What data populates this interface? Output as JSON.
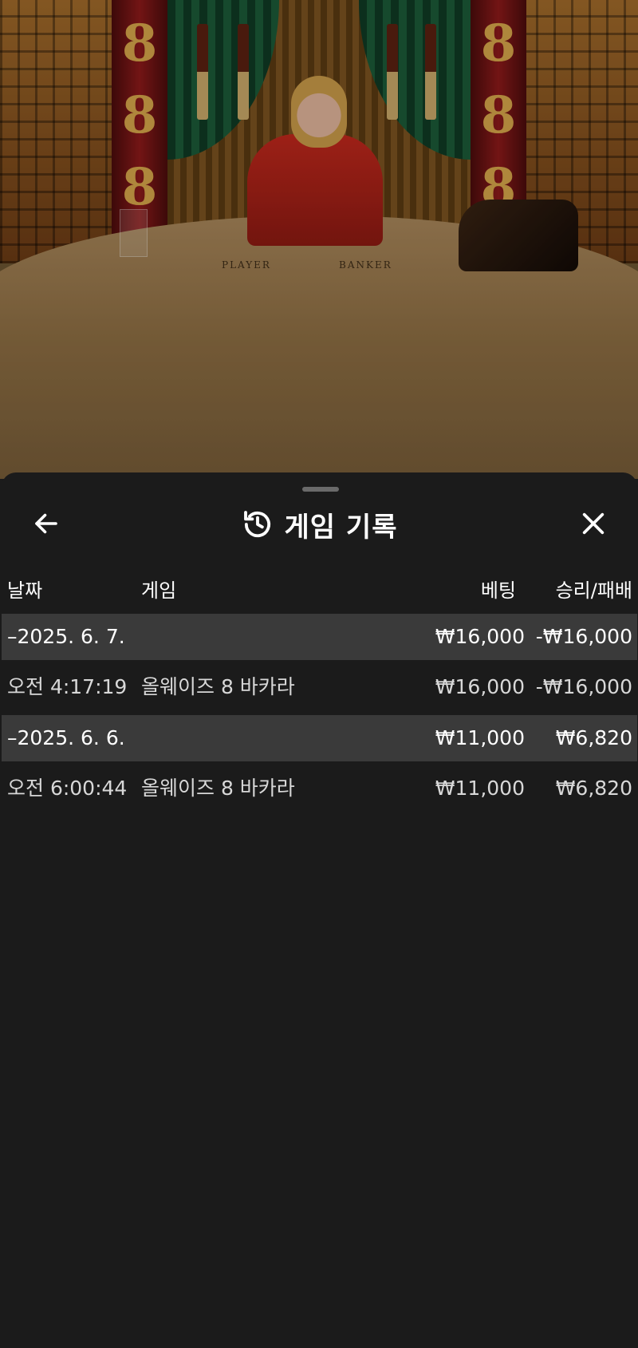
{
  "video": {
    "table_labels": {
      "player": "PLAYER",
      "banker": "BANKER"
    },
    "pillar_glyph": "8"
  },
  "sheet": {
    "title": "게임 기록",
    "icons": {
      "back": "arrow-left-icon",
      "history": "history-icon",
      "close": "close-icon"
    }
  },
  "columns": {
    "date": "날짜",
    "game": "게임",
    "bet": "베팅",
    "winloss": "승리/패배"
  },
  "rows": [
    {
      "type": "date",
      "date": "–2025. 6. 7.",
      "bet": "₩16,000",
      "winloss": "-₩16,000"
    },
    {
      "type": "item",
      "time": "오전 4:17:19",
      "game": "올웨이즈 8 바카라",
      "bet": "₩16,000",
      "winloss": "-₩16,000"
    },
    {
      "type": "date",
      "date": "–2025. 6. 6.",
      "bet": "₩11,000",
      "winloss": "₩6,820"
    },
    {
      "type": "item",
      "time": "오전 6:00:44",
      "game": "올웨이즈 8 바카라",
      "bet": "₩11,000",
      "winloss": "₩6,820"
    }
  ],
  "colors": {
    "sheet_bg": "#1b1b1b",
    "date_row_bg": "#3a3a3a",
    "text": "#ffffff"
  }
}
